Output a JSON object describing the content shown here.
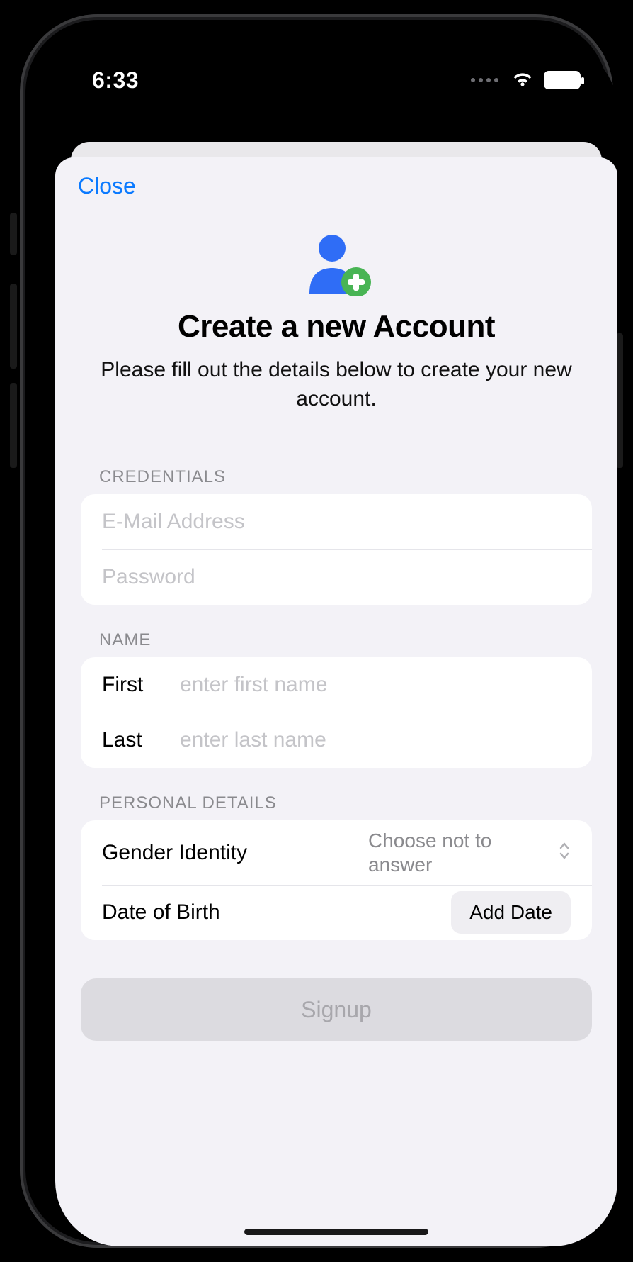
{
  "status": {
    "time": "6:33"
  },
  "nav": {
    "close": "Close"
  },
  "hero": {
    "title": "Create a new Account",
    "subtitle": "Please fill out the details below to create your new account."
  },
  "sections": {
    "credentials": {
      "header": "CREDENTIALS",
      "email_placeholder": "E-Mail Address",
      "password_placeholder": "Password"
    },
    "name": {
      "header": "NAME",
      "first_label": "First",
      "first_placeholder": "enter first name",
      "last_label": "Last",
      "last_placeholder": "enter last name"
    },
    "personal": {
      "header": "PERSONAL DETAILS",
      "gender_label": "Gender Identity",
      "gender_value": "Choose not to answer",
      "dob_label": "Date of Birth",
      "dob_button": "Add Date"
    }
  },
  "actions": {
    "signup": "Signup"
  }
}
